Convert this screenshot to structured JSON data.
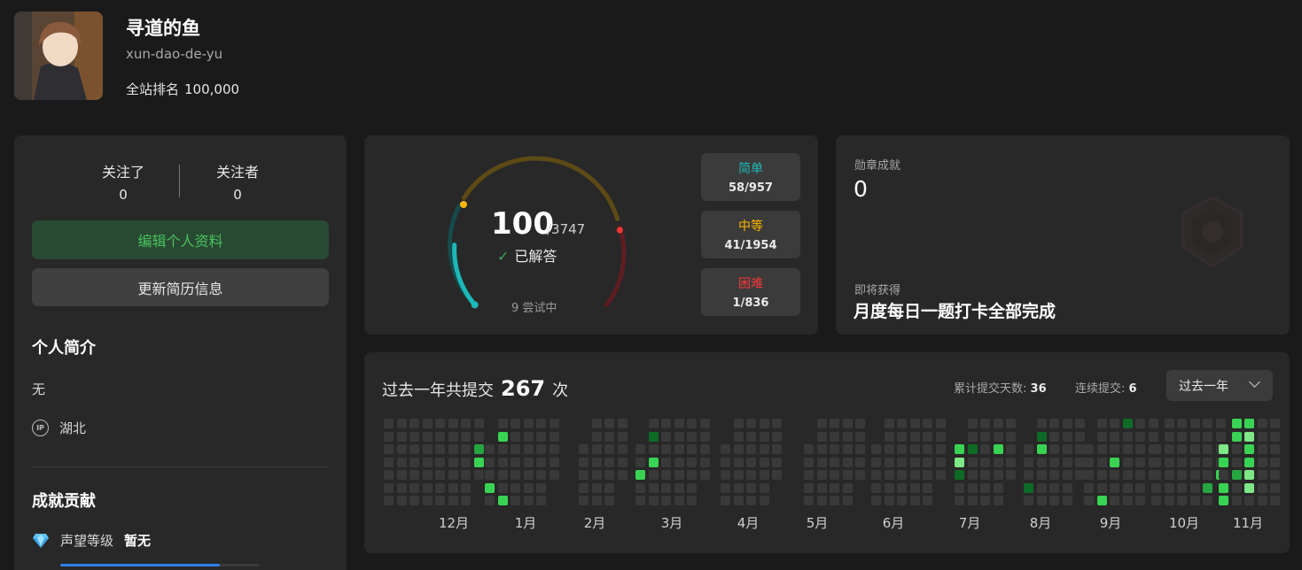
{
  "profile": {
    "name": "寻道的鱼",
    "slug": "xun-dao-de-yu",
    "rank_label": "全站排名",
    "rank_value": "100,000"
  },
  "left": {
    "following_label": "关注了",
    "following_count": "0",
    "followers_label": "关注者",
    "followers_count": "0",
    "edit_button": "编辑个人资料",
    "resume_button": "更新简历信息",
    "bio_title": "个人简介",
    "bio_text": "无",
    "location_icon": "IP",
    "location": "湖北",
    "contrib_title": "成就贡献",
    "reputation_label": "声望等级",
    "reputation_value": "暂无",
    "reputation_progress": 0.8
  },
  "progress": {
    "solved": "100",
    "total": "/3747",
    "solved_label": "已解答",
    "attempting": "9 尝试中",
    "difficulties": [
      {
        "label": "简单",
        "value": "58/957",
        "color": "#1cb8b8"
      },
      {
        "label": "中等",
        "value": "41/1954",
        "color": "#ffb700"
      },
      {
        "label": "困难",
        "value": "1/836",
        "color": "#f63737"
      }
    ]
  },
  "badges": {
    "title": "勋章成就",
    "count": "0",
    "upcoming_label": "即将获得",
    "upcoming_name": "月度每日一题打卡全部完成"
  },
  "heatmap": {
    "prefix": "过去一年共提交",
    "count": "267",
    "suffix": "次",
    "days_label": "累计提交天数:",
    "days_value": "36",
    "streak_label": "连续提交:",
    "streak_value": "6",
    "range_select": "过去一年",
    "months": [
      "12月",
      "1月",
      "2月",
      "3月",
      "4月",
      "5月",
      "6月",
      "7月",
      "8月",
      "9月",
      "10月",
      "11月"
    ],
    "colors": [
      "#393939",
      "#0e6b26",
      "#26a641",
      "#39d353",
      "#7ee787"
    ]
  }
}
